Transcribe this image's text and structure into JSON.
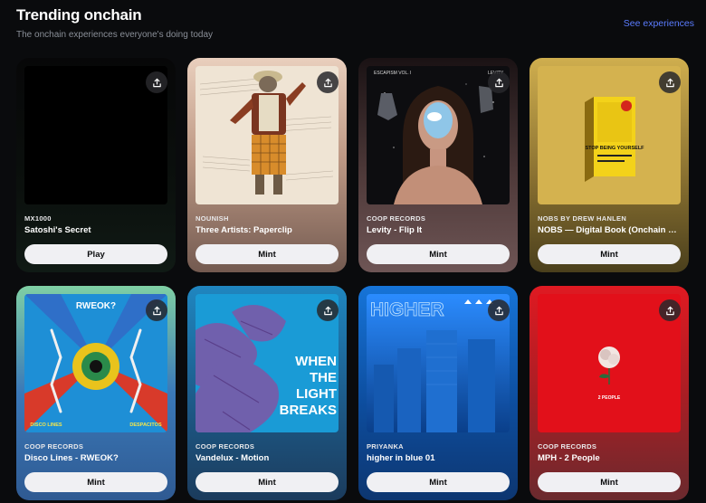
{
  "header": {
    "title": "Trending onchain",
    "subtitle": "The onchain experiences everyone's doing today",
    "see_link": "See experiences"
  },
  "cards": [
    {
      "creator": "MX1000",
      "name": "Satoshi's Secret",
      "action": "Play",
      "bg": "linear-gradient(180deg,#070708 0%,#0b100d 60%,#101a15 100%)"
    },
    {
      "creator": "NOUNISH",
      "name": "Three Artists: Paperclip",
      "action": "Mint",
      "bg": "linear-gradient(180deg,#e9cfbd 0%,#bf9a86 45%,#735a50 100%)"
    },
    {
      "creator": "COOP RECORDS",
      "name": "Levity - Flip It",
      "action": "Mint",
      "bg": "linear-gradient(180deg,#1a1214 0%,#4f3a3a 55%,#6e5555 100%)"
    },
    {
      "creator": "NOBS BY DREW HANLEN",
      "name": "NOBS — Digital Book (Onchain Edition)",
      "action": "Mint",
      "bg": "linear-gradient(180deg,#cfae4e 0%,#8a7131 55%,#4a3f1c 100%)"
    },
    {
      "creator": "COOP RECORDS",
      "name": "Disco Lines - RWEOK?",
      "action": "Mint",
      "bg": "linear-gradient(180deg,#7fcfa4 0%,#3a78b8 50%,#2f5a92 100%)"
    },
    {
      "creator": "COOP RECORDS",
      "name": "Vandelux - Motion",
      "action": "Mint",
      "bg": "linear-gradient(180deg,#1f86c0 0%,#1d5a88 55%,#1b3b5c 100%)"
    },
    {
      "creator": "PRIYANKA",
      "name": "higher in blue 01",
      "action": "Mint",
      "bg": "linear-gradient(180deg,#1674d8 0%,#0d4d9e 55%,#0d3670 100%)"
    },
    {
      "creator": "COOP RECORDS",
      "name": "MPH - 2 People",
      "action": "Mint",
      "bg": "linear-gradient(180deg,#e01a22 0%,#a91e24 50%,#6a2a2e 100%)"
    }
  ],
  "artwork_text": {
    "levity_left": "ESCAPISM VOL. I",
    "levity_right": "LEVITY",
    "nobs_cover": "STOP BEING YOURSELF",
    "rweok_title": "RWEOK?",
    "rweok_left": "DISCO LINES",
    "rweok_right": "DESPACITOS",
    "vandelux_text": "WHEN THE LIGHT BREAKS",
    "higher_text": "HIGHER",
    "mph_text": "2 PEOPLE"
  }
}
